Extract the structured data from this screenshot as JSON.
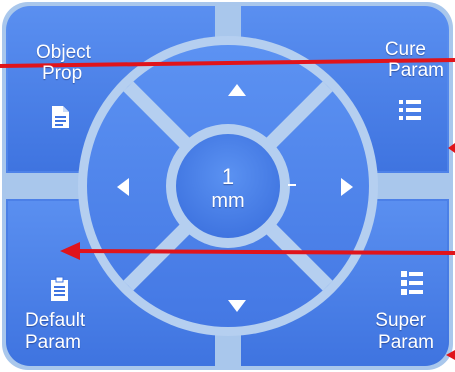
{
  "colors": {
    "panel_fill": "#4a7fe8",
    "panel_border": "#a9c7ec",
    "wheel_fill": "#4f86ea",
    "wheel_ring": "#b5cff0",
    "text": "#ffffff",
    "annotation_arrow": "#e0141b"
  },
  "corners": {
    "top_left": {
      "line1": "Object",
      "line2": "Prop",
      "icon": "document-icon"
    },
    "top_right": {
      "line1": "Cure",
      "line2": "Param",
      "icon": "list-icon"
    },
    "bottom_left": {
      "line1": "Default",
      "line2": "Param",
      "icon": "clipboard-icon"
    },
    "bottom_right": {
      "line1": "Super",
      "line2": "Param",
      "icon": "list-grid-icon"
    }
  },
  "wheel": {
    "step_value": "1",
    "step_unit": "mm",
    "icons": [
      "arrow-up-icon",
      "arrow-down-icon",
      "arrow-left-icon",
      "arrow-right-icon"
    ]
  }
}
